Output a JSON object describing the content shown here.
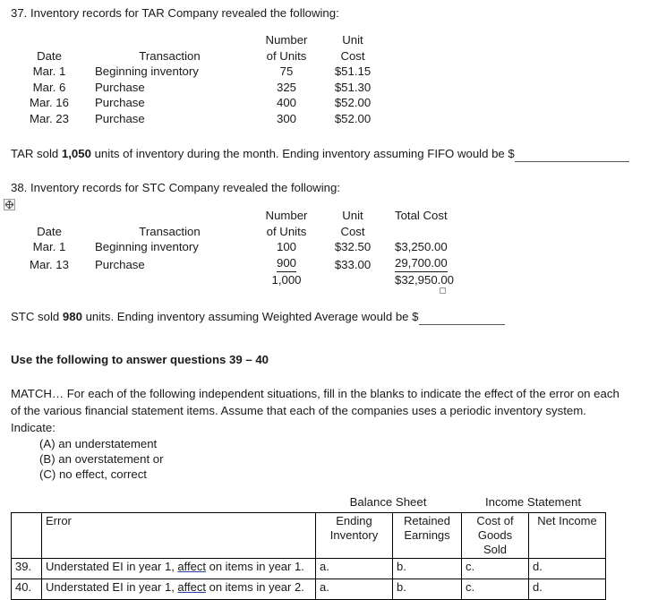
{
  "document": {
    "q37": {
      "prompt": "37. Inventory records for TAR Company revealed the following:",
      "headers": {
        "number": "Number",
        "of_units": "of Units",
        "unit": "Unit",
        "cost": "Cost",
        "date": "Date",
        "transaction": "Transaction"
      },
      "rows": [
        {
          "date": "Mar. 1",
          "transaction": "Beginning inventory",
          "units": "75",
          "unit_cost": "$51.15"
        },
        {
          "date": "Mar. 6",
          "transaction": "Purchase",
          "units": "325",
          "unit_cost": "$51.30"
        },
        {
          "date": "Mar. 16",
          "transaction": "Purchase",
          "units": "400",
          "unit_cost": "$52.00"
        },
        {
          "date": "Mar. 23",
          "transaction": "Purchase",
          "units": "300",
          "unit_cost": "$52.00"
        }
      ],
      "footer_pre": "TAR sold ",
      "footer_bold": "1,050",
      "footer_post": " units of inventory during the month. Ending inventory assuming FIFO would be $"
    },
    "q38": {
      "prompt": "38. Inventory records for STC Company revealed the following:",
      "headers": {
        "number": "Number",
        "of_units": "of Units",
        "unit": "Unit",
        "cost": "Cost",
        "total_cost": "Total Cost",
        "date": "Date",
        "transaction": "Transaction"
      },
      "rows": [
        {
          "date": "Mar. 1",
          "transaction": "Beginning inventory",
          "units": "100",
          "unit_cost": "$32.50",
          "total_cost": "$3,250.00"
        },
        {
          "date": "Mar. 13",
          "transaction": "Purchase",
          "units": "900",
          "unit_cost": "$33.00",
          "total_cost": "29,700.00"
        }
      ],
      "totals": {
        "units": "1,000",
        "total_cost": "$32,950.00"
      },
      "footer_pre": "STC sold ",
      "footer_bold": "980",
      "footer_post": " units. Ending inventory assuming Weighted Average would be $"
    },
    "instructions": {
      "heading": "Use the following to answer questions 39 – 40",
      "line1": "MATCH… For each of the following independent situations, fill in the blanks to indicate the effect of the error on each",
      "line2": "of the various financial statement items.  Assume that each of the companies uses a periodic inventory system.",
      "line3": "Indicate:",
      "options": [
        "(A) an understatement",
        "(B) an overstatement or",
        "(C)  no effect, correct"
      ]
    },
    "match_table": {
      "group_headers": {
        "balance_sheet": "Balance Sheet",
        "income_statement": "Income Statement"
      },
      "columns": {
        "num": "",
        "error": "Error",
        "ending_inventory_l1": "Ending",
        "ending_inventory_l2": "Inventory",
        "retained_earnings_l1": "Retained",
        "retained_earnings_l2": "Earnings",
        "cogs_l1": "Cost of",
        "cogs_l2": "Goods Sold",
        "net_income_l1": "Net Income",
        "net_income_l2": ""
      },
      "rows": [
        {
          "num": "39.",
          "error_pre": "Understated EI in year 1, ",
          "error_link": "affect",
          "error_post": " on items in year 1.",
          "a": "a.",
          "b": "b.",
          "c": "c.",
          "d": "d."
        },
        {
          "num": "40.",
          "error_pre": "Understated EI in year 1, ",
          "error_link": "affect",
          "error_post": " on items in year 2.",
          "a": "a.",
          "b": "b.",
          "c": "c.",
          "d": "d."
        }
      ]
    },
    "icons": {
      "move_handle": "table-move-handle-icon",
      "resize_square": "table-resize-handle-icon"
    }
  }
}
